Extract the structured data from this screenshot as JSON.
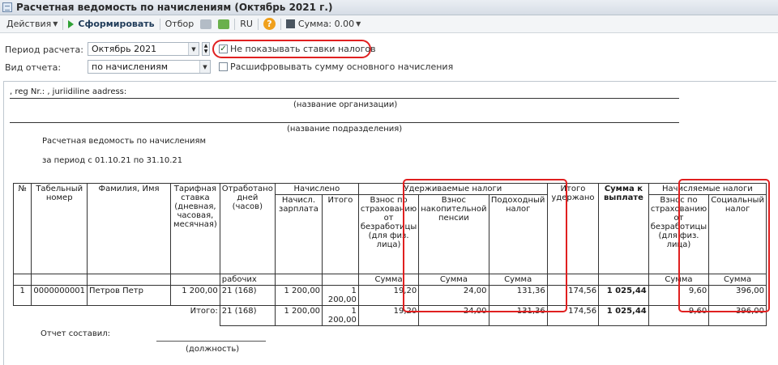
{
  "window": {
    "title": "Расчетная ведомость по начислениям (Октябрь 2021 г.)"
  },
  "toolbar": {
    "actions_label": "Действия",
    "generate_label": "Сформировать",
    "filter_label": "Отбор",
    "lang_label": "RU",
    "help_label": "?",
    "sum_label": "Сумма: 0.00"
  },
  "form": {
    "period_label": "Период расчета:",
    "period_value": "Октябрь 2021",
    "report_type_label": "Вид отчета:",
    "report_type_value": "по начислениям",
    "hide_tax_rates_label": "Не показывать ставки налогов",
    "hide_tax_rates_checked": true,
    "decode_main_accrual_label": "Расшифровывать сумму основного начисления",
    "decode_main_accrual_checked": false
  },
  "report": {
    "org_line": ", reg Nr.: , juriidiline aadress:",
    "org_caption": "(название организации)",
    "dept_caption": "(название подразделения)",
    "title": "Расчетная ведомость по начислениям",
    "period": "за период с 01.10.21 по 31.10.21",
    "headers": {
      "no": "№",
      "tab_no": "Табельный номер",
      "name": "Фамилия, Имя",
      "rate": "Тарифная ставка (дневная, часовая, месячная)",
      "worked": "Отработано дней (часов)",
      "worked_sub": "рабочих",
      "accrued": "Начислено",
      "accrued_salary": "Начисл. зарплата",
      "accrued_total": "Итого",
      "withheld": "Удерживаемые налоги",
      "unemp_ins": "Взнос по страхованию от безработицы (для физ. лица)",
      "pension": "Взнос накопительной пенсии",
      "income_tax": "Подоходный налог",
      "sum_sub": "Сумма",
      "total_withheld": "Итого удержано",
      "to_pay": "Сумма к выплате",
      "charged": "Начисляемые налоги",
      "employer_unemp": "Взнос по страхованию от безработицы (для физ. лица)",
      "social_tax": "Социальный налог"
    },
    "rows": [
      {
        "no": "1",
        "tab_no": "0000000001",
        "name": "Петров Петр",
        "rate": "1 200,00",
        "worked": "21 (168)",
        "salary": "1 200,00",
        "total": "1 200,00",
        "unemp": "19,20",
        "pension": "24,00",
        "income_tax": "131,36",
        "withheld_total": "174,56",
        "to_pay": "1 025,44",
        "emp_unemp": "9,60",
        "social": "396,00"
      }
    ],
    "totals": {
      "label": "Итого:",
      "worked": "21 (168)",
      "salary": "1 200,00",
      "total": "1 200,00",
      "unemp": "19,20",
      "pension": "24,00",
      "income_tax": "131,36",
      "withheld_total": "174,56",
      "to_pay": "1 025,44",
      "emp_unemp": "9,60",
      "social": "396,00"
    },
    "compiled_label": "Отчет составил:",
    "position_caption": "(должность)"
  }
}
